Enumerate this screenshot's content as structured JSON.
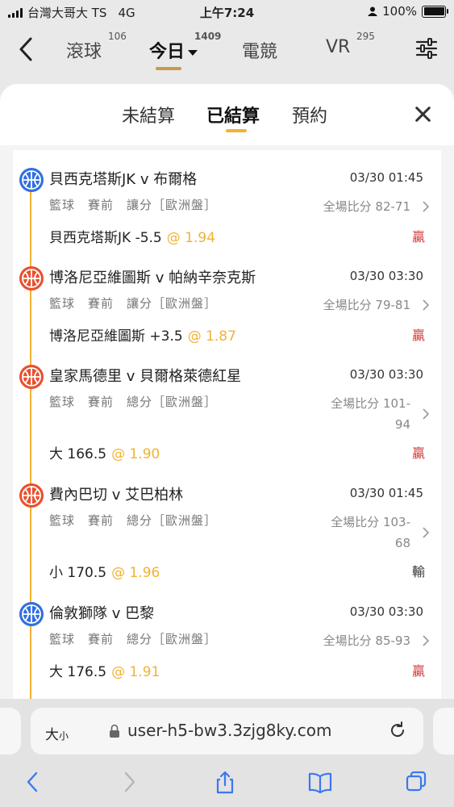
{
  "status_bar": {
    "carrier": "台灣大哥大 TS",
    "network": "4G",
    "time": "上午7:24",
    "battery": "100%"
  },
  "top_nav": {
    "tabs": [
      {
        "label": "滾球",
        "count": "106"
      },
      {
        "label": "今日",
        "count": "1409"
      },
      {
        "label": "電競",
        "count": ""
      },
      {
        "label": "VR",
        "count": "295"
      }
    ],
    "active_tab": "今日"
  },
  "sheet": {
    "tabs": [
      "未結算",
      "已結算",
      "預約"
    ],
    "active_tab": "已結算"
  },
  "bets": [
    {
      "match": "貝西克塔斯JK v 布爾格",
      "time": "03/30 01:45",
      "meta": "籃球　賽前　讓分［歐洲盤］",
      "score_label": "全場比分",
      "score": "82-71",
      "selection": "貝西克塔斯JK -5.5",
      "odds": "@ 1.94",
      "result": "贏",
      "logo_color": "#2f6fe0"
    },
    {
      "match": "博洛尼亞維圖斯 v 帕納辛奈克斯",
      "time": "03/30 03:30",
      "meta": "籃球　賽前　讓分［歐洲盤］",
      "score_label": "全場比分",
      "score": "79-81",
      "selection": "博洛尼亞維圖斯 +3.5",
      "odds": "@ 1.87",
      "result": "贏",
      "logo_color": "#e8502d"
    },
    {
      "match": "皇家馬德里 v 貝爾格萊德紅星",
      "time": "03/30 03:30",
      "meta": "籃球　賽前　總分［歐洲盤］",
      "score_label": "全場比分",
      "score_line1": "101-",
      "score_line2": "94",
      "selection": "大 166.5",
      "odds": "@ 1.90",
      "result": "贏",
      "logo_color": "#e8502d"
    },
    {
      "match": "費內巴切 v 艾巴柏林",
      "time": "03/30 01:45",
      "meta": "籃球　賽前　總分［歐洲盤］",
      "score_label": "全場比分",
      "score_line1": "103-",
      "score_line2": "68",
      "selection": "小 170.5",
      "odds": "@ 1.96",
      "result": "輸",
      "logo_color": "#e8502d"
    },
    {
      "match": "倫敦獅隊 v 巴黎",
      "time": "03/30 03:30",
      "meta": "籃球　賽前　總分［歐洲盤］",
      "score_label": "全場比分",
      "score": "85-93",
      "selection": "大 176.5",
      "odds": "@ 1.91",
      "result": "贏",
      "logo_color": "#2f6fe0"
    }
  ],
  "browser": {
    "text_size_label": "大",
    "text_size_small": "小",
    "url": "user-h5-bw3.3zjg8ky.com"
  },
  "colors": {
    "accent": "#f2b233",
    "win": "#d43b3b",
    "lose": "#333333"
  },
  "icons": [
    "back-arrow-icon",
    "filter-sliders-icon",
    "close-icon",
    "chevron-right-icon",
    "lock-icon",
    "reload-icon",
    "share-icon",
    "bookmarks-icon",
    "tabs-icon"
  ]
}
